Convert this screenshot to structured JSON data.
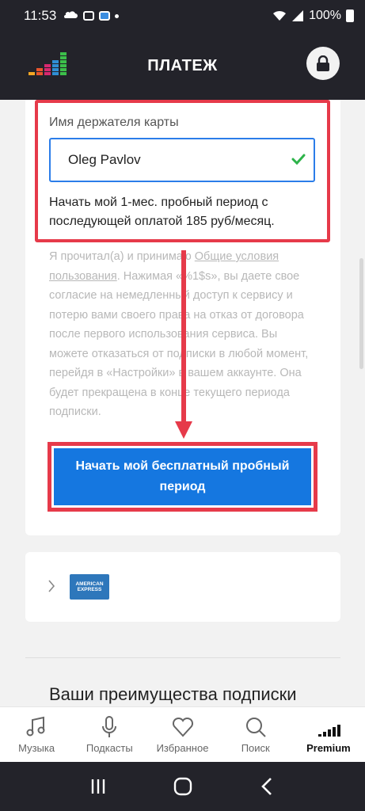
{
  "status": {
    "time": "11:53",
    "battery": "100%"
  },
  "header": {
    "title": "ПЛАТЕЖ"
  },
  "form": {
    "label": "Имя держателя карты",
    "name_value": "Oleg Pavlov",
    "trial_text": "Начать мой 1-мес. пробный период с последующей оплатой 185 руб/месяц."
  },
  "terms": {
    "prefix": "Я прочитал(а) и принимаю ",
    "link": "Общие условия пользования",
    "rest": ". Нажимая «%1$s», вы даете свое согласие на немедленный доступ к сервису и потерю вами своего права на отказ от договора после первого использования сервиса. Вы можете отказаться от подписки в любой момент, перейдя в «Настройки» в вашем аккаунте. Она будет прекращена в конце текущего периода подписки."
  },
  "cta": {
    "label": "Начать мой бесплатный пробный период"
  },
  "payment": {
    "card_brand_line1": "AMERICAN",
    "card_brand_line2": "EXPRESS"
  },
  "benefits": {
    "title": "Ваши преимущества подписки"
  },
  "nav": {
    "items": [
      {
        "label": "Музыка",
        "icon": "music-note-icon"
      },
      {
        "label": "Подкасты",
        "icon": "microphone-icon"
      },
      {
        "label": "Избранное",
        "icon": "heart-icon"
      },
      {
        "label": "Поиск",
        "icon": "search-icon"
      },
      {
        "label": "Premium",
        "icon": "equalizer-icon"
      }
    ]
  },
  "colors": {
    "accent": "#1577e0",
    "highlight": "#e63a4a",
    "dark": "#23232a",
    "check": "#2db34a"
  }
}
